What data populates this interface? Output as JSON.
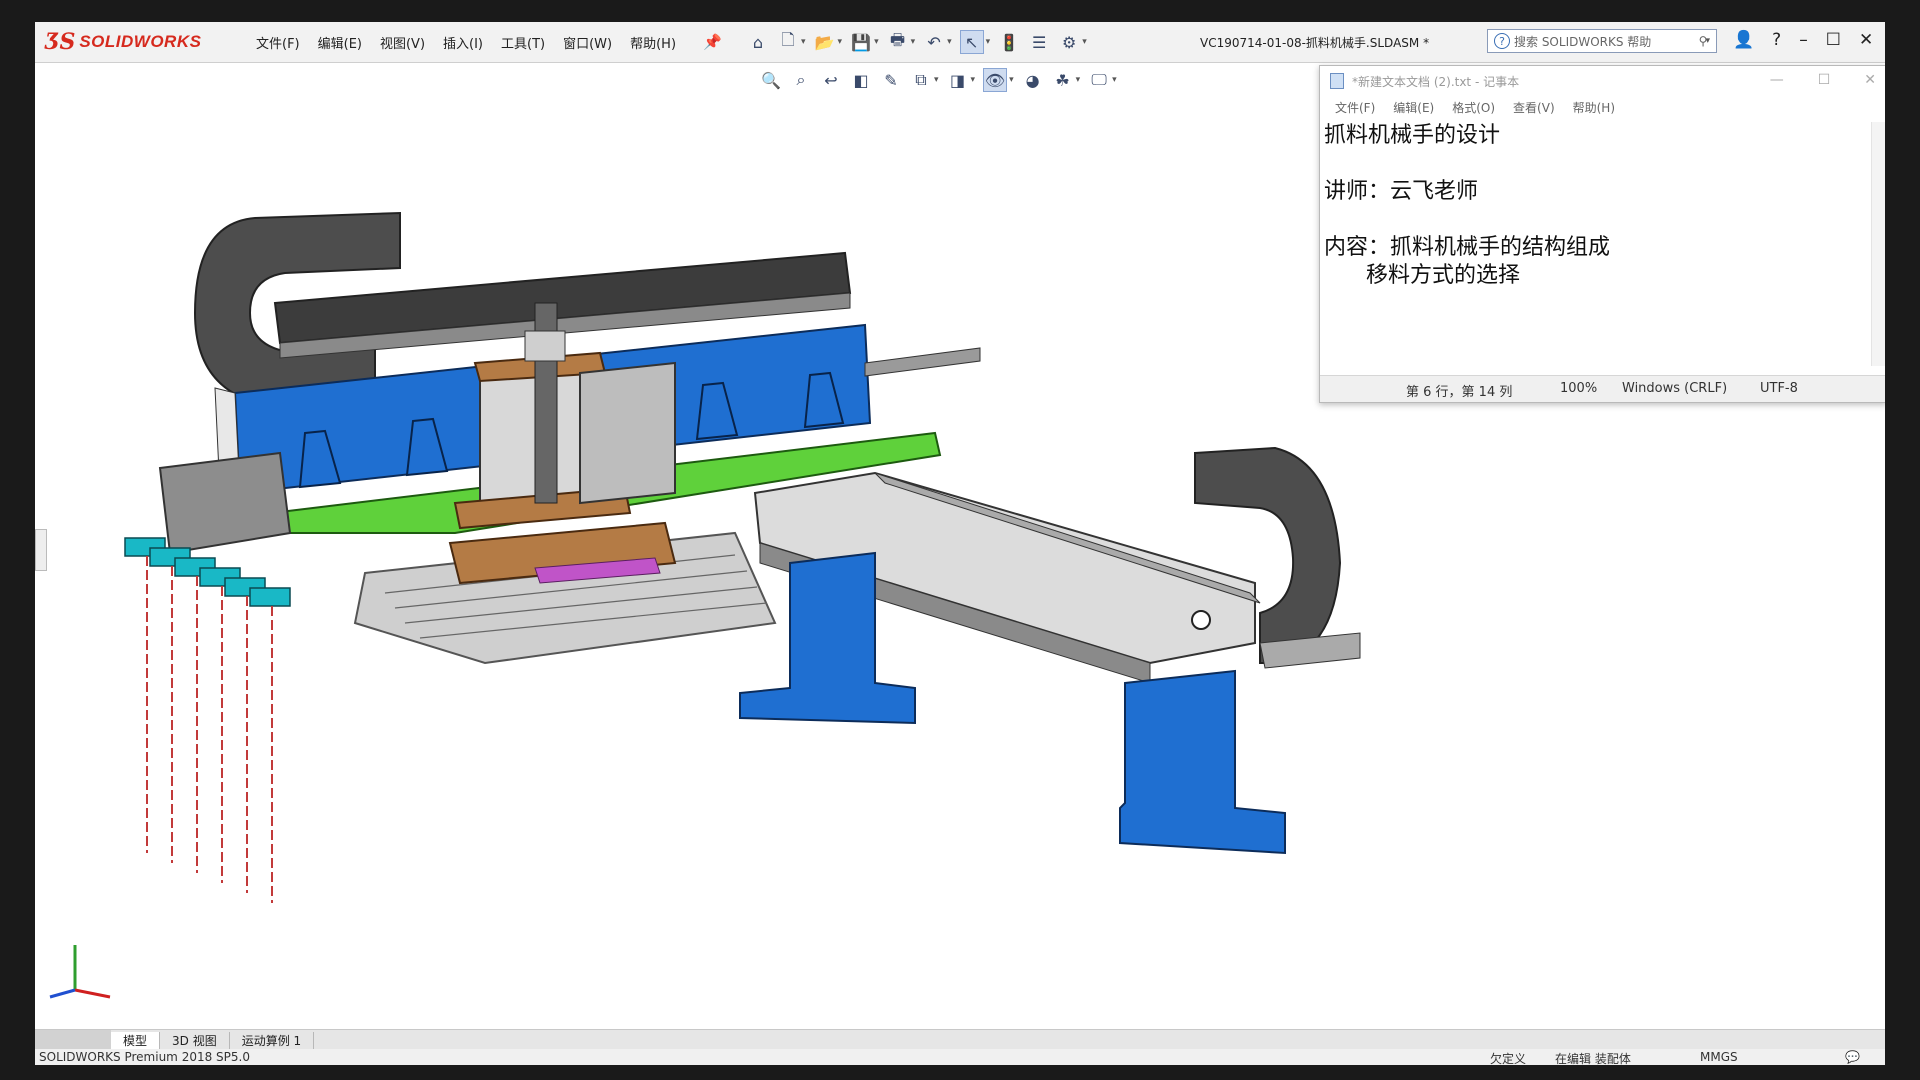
{
  "app": {
    "brand": "SOLIDWORKS",
    "menu": [
      "文件(F)",
      "编辑(E)",
      "视图(V)",
      "插入(I)",
      "工具(T)",
      "窗口(W)",
      "帮助(H)"
    ],
    "document_title": "VC190714-01-08-抓料机械手.SLDASM *",
    "search_placeholder": "搜索 SOLIDWORKS 帮助",
    "colors": {
      "accent_blue": "#1f6fd1",
      "brand_red": "#d62a1e",
      "plate_green": "#5fd13b",
      "bronze": "#b47b45",
      "chain_dark": "#4a4a4a"
    }
  },
  "notepad": {
    "title": "*新建文本文档 (2).txt - 记事本",
    "menu": [
      "文件(F)",
      "编辑(E)",
      "格式(O)",
      "查看(V)",
      "帮助(H)"
    ],
    "lines": [
      "抓料机械手的设计",
      "",
      "讲师：云飞老师",
      "",
      "内容：抓料机械手的结构组成",
      "      移料方式的选择"
    ],
    "status": {
      "position": "第 6 行，第 14 列",
      "zoom": "100%",
      "line_ending": "Windows (CRLF)",
      "encoding": "UTF-8"
    }
  },
  "tabs": [
    "模型",
    "3D 视图",
    "运动算例 1"
  ],
  "status_bar": {
    "product": "SOLIDWORKS Premium 2018 SP5.0",
    "state1": "欠定义",
    "state2": "在编辑 装配体",
    "units": "MMGS"
  }
}
